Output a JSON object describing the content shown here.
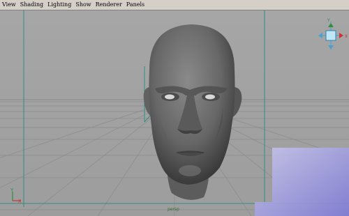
{
  "menubar": {
    "items": [
      "View",
      "Shading",
      "Lighting",
      "Show",
      "Renderer",
      "Panels"
    ]
  },
  "viewport": {
    "camera_label": "persp",
    "view_cube": {
      "top_label": "Y",
      "right_label": "X"
    },
    "origin_axis": {
      "y_label": "Y",
      "x_label": "X"
    }
  },
  "colors": {
    "menu_bg": "#d4d0c8",
    "viewport_bg": "#a4a4a4",
    "grid": "#8c8c8c",
    "axis_line": "#2a8a7a",
    "head_mid": "#6e6e6e",
    "corner_tint": "#8d8ad8"
  }
}
